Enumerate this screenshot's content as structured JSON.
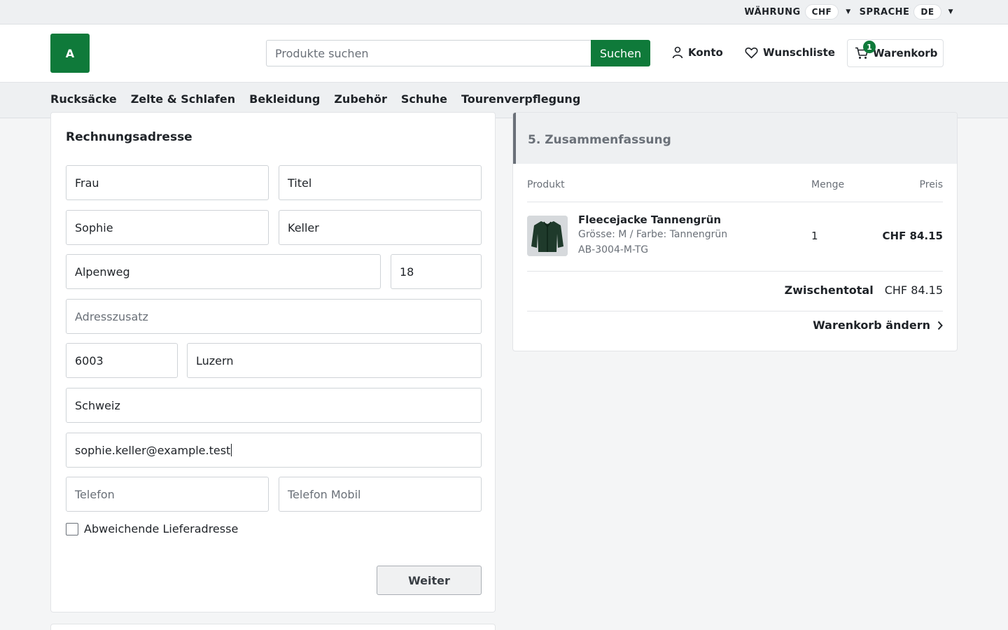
{
  "topbar": {
    "currency_label": "WÄHRUNG",
    "currency_value": "CHF",
    "language_label": "SPRACHE",
    "language_value": "DE"
  },
  "header": {
    "logo_text": "A",
    "search_placeholder": "Produkte suchen",
    "search_button": "Suchen",
    "account_label": "Konto",
    "wishlist_label": "Wunschliste",
    "cart_label": "Warenkorb",
    "cart_count": "1"
  },
  "nav": {
    "items": [
      "Rucksäcke",
      "Zelte & Schlafen",
      "Bekleidung",
      "Zubehör",
      "Schuhe",
      "Tourenverpflegung"
    ]
  },
  "billing": {
    "title": "Rechnungsadresse",
    "salutation": "Frau",
    "title_field": "Titel",
    "first_name": "Sophie",
    "last_name": "Keller",
    "street": "Alpenweg",
    "house_number": "18",
    "address_extra_placeholder": "Adresszusatz",
    "zip": "6003",
    "city": "Luzern",
    "country": "Schweiz",
    "email": "sophie.keller@example.test",
    "phone_placeholder": "Telefon",
    "mobile_placeholder": "Telefon Mobil",
    "different_shipping_label": "Abweichende Lieferadresse",
    "different_shipping_checked": false,
    "next_button": "Weiter"
  },
  "summary": {
    "title": "5. Zusammenfassung",
    "col_product": "Produkt",
    "col_qty": "Menge",
    "col_price": "Preis",
    "item": {
      "name": "Fleecejacke Tannengrün",
      "variant": "Grösse: M / Farbe: Tannengrün",
      "sku": "AB-3004-M-TG",
      "qty": "1",
      "price": "CHF 84.15"
    },
    "subtotal_label": "Zwischentotal",
    "subtotal_value": "CHF 84.15",
    "edit_cart": "Warenkorb ändern"
  },
  "colors": {
    "brand_green": "#0f7a3a"
  }
}
